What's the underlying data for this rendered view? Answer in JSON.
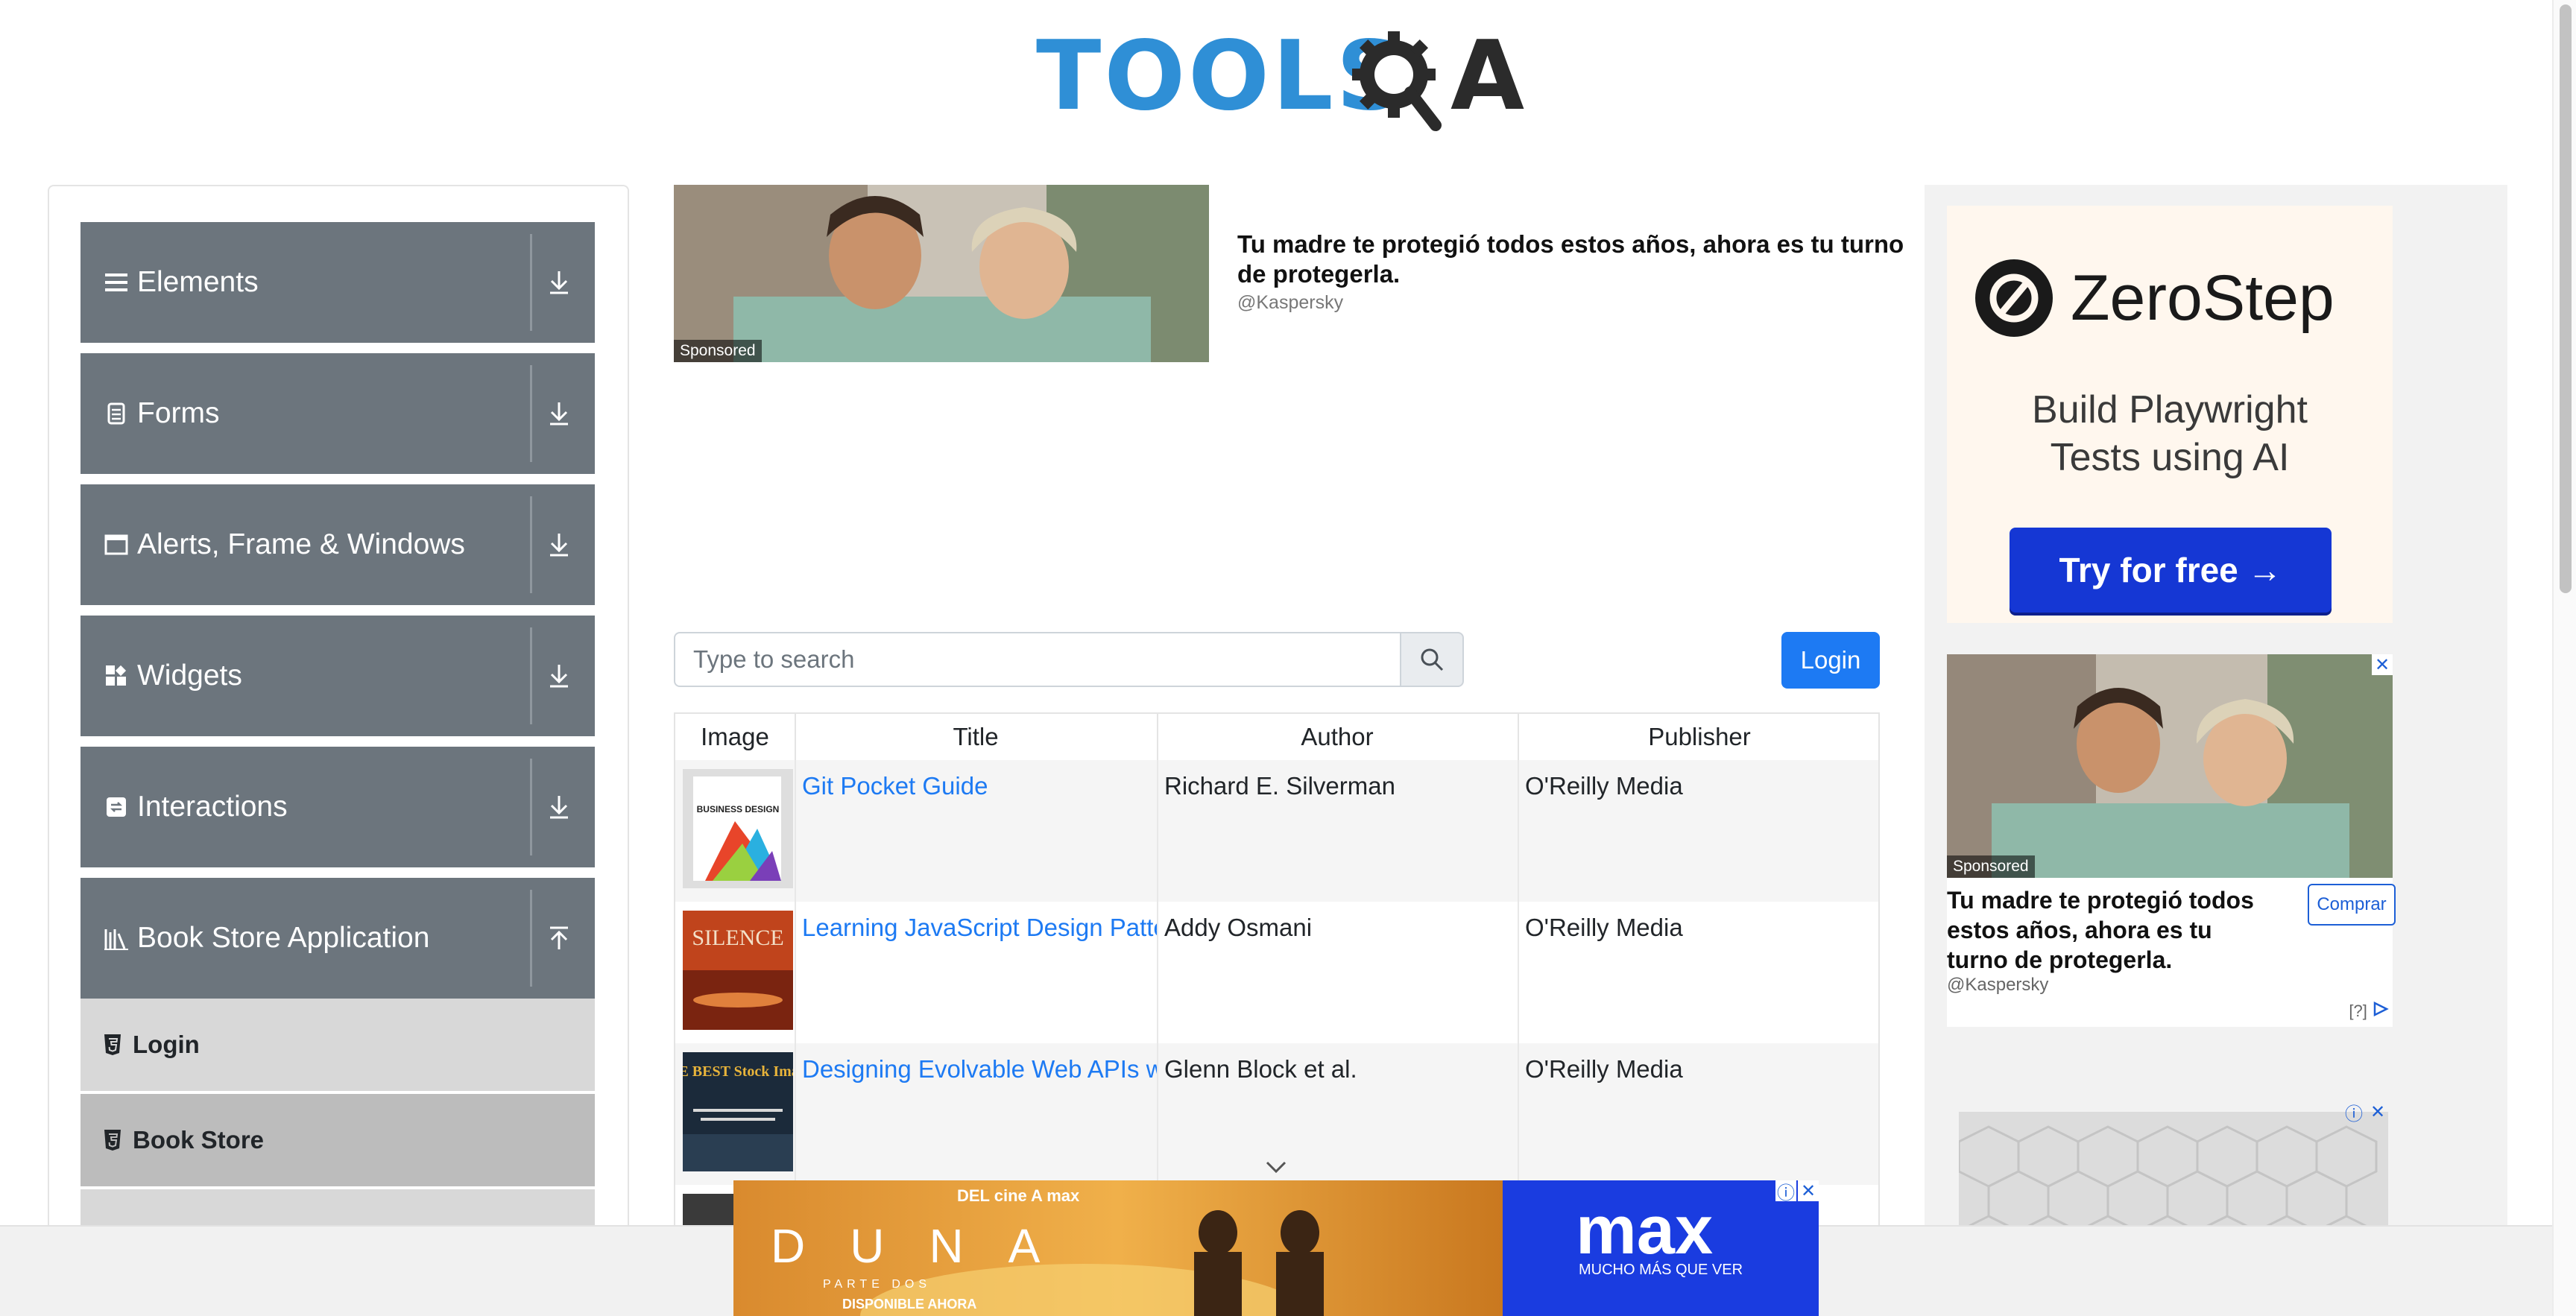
{
  "header": {
    "logo_text": "TOOLS",
    "logo_a": "A"
  },
  "sidebar": {
    "groups": [
      {
        "label": "Elements",
        "icon": "hamburger-icon"
      },
      {
        "label": "Forms",
        "icon": "document-icon"
      },
      {
        "label": "Alerts, Frame & Windows",
        "icon": "window-icon"
      },
      {
        "label": "Widgets",
        "icon": "widgets-icon"
      },
      {
        "label": "Interactions",
        "icon": "interactions-icon"
      },
      {
        "label": "Book Store Application",
        "icon": "library-icon"
      }
    ],
    "book_store_items": [
      {
        "label": "Login"
      },
      {
        "label": "Book Store"
      }
    ]
  },
  "top_ad": {
    "sponsored": "Sponsored",
    "title": "Tu madre te protegió todos estos años, ahora es tu turno de protegerla.",
    "handle": "@Kaspersky"
  },
  "search": {
    "placeholder": "Type to search"
  },
  "login_button": "Login",
  "table": {
    "headers": [
      "Image",
      "Title",
      "Author",
      "Publisher"
    ],
    "rows": [
      {
        "title": "Git Pocket Guide",
        "author": "Richard E. Silverman",
        "publisher": "O'Reilly Media",
        "cover_text": "BUSINESS DESIGN"
      },
      {
        "title": "Learning JavaScript Design Patterns",
        "author": "Addy Osmani",
        "publisher": "O'Reilly Media",
        "cover_text": "SILENCE"
      },
      {
        "title": "Designing Evolvable Web APIs with ASP.NET",
        "author": "Glenn Block et al.",
        "publisher": "O'Reilly Media",
        "cover_text": "THE BEST Stock Images"
      }
    ]
  },
  "right_ad": {
    "brand": "ZeroStep",
    "headline_line1": "Build Playwright",
    "headline_line2": "Tests using AI",
    "cta": "Try for free →",
    "sponsored": "Sponsored",
    "title": "Tu madre te protegió todos estos años, ahora es tu turno de protegerla.",
    "handle": "@Kaspersky",
    "buy": "Comprar",
    "info": "[?]"
  },
  "bottom_ad": {
    "top_line": "DEL cine A max",
    "movie": "DUNA",
    "subtitle": "PARTE DOS",
    "available": "DISPONIBLE AHORA",
    "brand": "max",
    "tagline": "MUCHO MÁS QUE VER"
  },
  "colors": {
    "sidebar_header": "#6c757d",
    "link": "#1d7af3",
    "login_button": "#1d7af3",
    "zerostep_cta": "#1537d4",
    "max_blue": "#1a3ce0"
  }
}
